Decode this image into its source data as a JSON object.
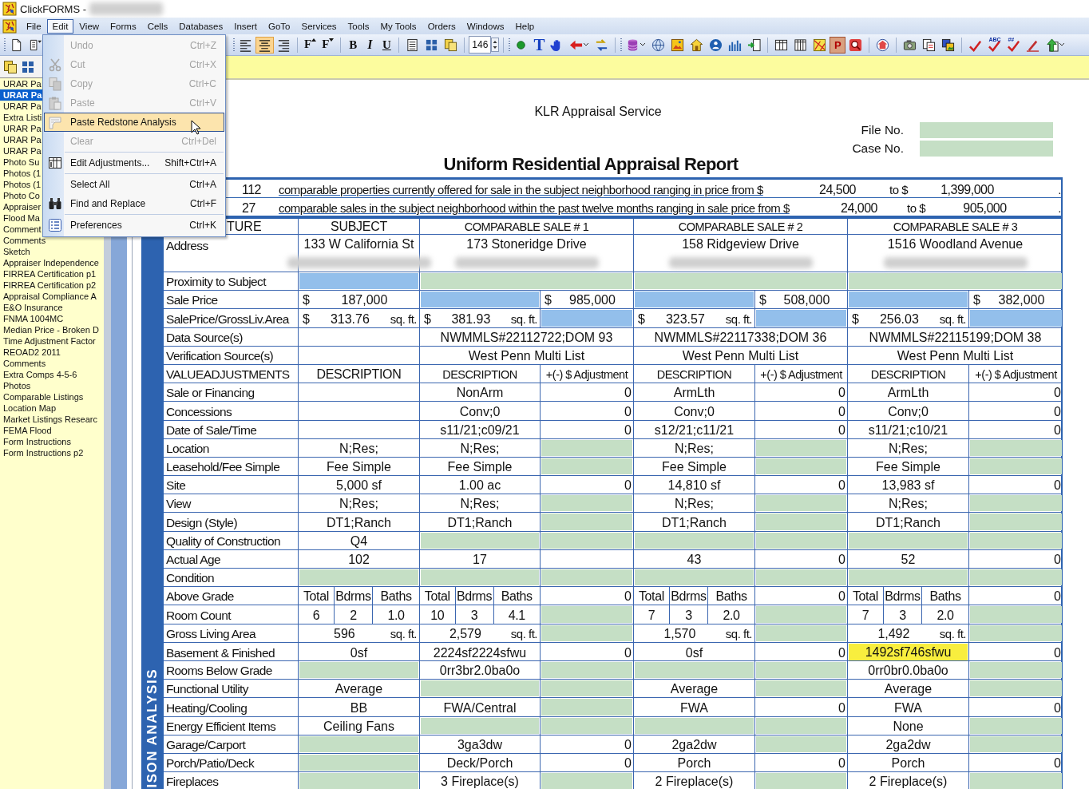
{
  "window": {
    "title": "ClickFORMS -"
  },
  "menubar": [
    {
      "label": "File",
      "selected": false
    },
    {
      "label": "Edit",
      "selected": true
    },
    {
      "label": "View",
      "selected": false
    },
    {
      "label": "Forms",
      "selected": false
    },
    {
      "label": "Cells",
      "selected": false
    },
    {
      "label": "Databases",
      "selected": false
    },
    {
      "label": "Insert",
      "selected": false
    },
    {
      "label": "GoTo",
      "selected": false
    },
    {
      "label": "Services",
      "selected": false
    },
    {
      "label": "Tools",
      "selected": false
    },
    {
      "label": "My Tools",
      "selected": false
    },
    {
      "label": "Orders",
      "selected": false
    },
    {
      "label": "Windows",
      "selected": false
    },
    {
      "label": "Help",
      "selected": false
    }
  ],
  "toolbar": {
    "left": [
      {
        "kind": "grip"
      },
      {
        "kind": "new",
        "pressed": false
      },
      {
        "kind": "docmenu",
        "pressed": false
      }
    ],
    "right": [
      {
        "kind": "grip"
      },
      {
        "kind": "alignleft",
        "pressed": false
      },
      {
        "kind": "aligncenter",
        "pressed": true
      },
      {
        "kind": "alignright",
        "pressed": false
      },
      {
        "kind": "sep"
      },
      {
        "kind": "fontup",
        "text": "F",
        "pressed": false
      },
      {
        "kind": "fontdown",
        "text": "F",
        "pressed": false
      },
      {
        "kind": "sep"
      },
      {
        "kind": "bold",
        "text": "B",
        "pressed": false
      },
      {
        "kind": "italic",
        "text": "I",
        "pressed": false
      },
      {
        "kind": "underline",
        "text": "U",
        "pressed": false
      },
      {
        "kind": "sep"
      },
      {
        "kind": "list",
        "pressed": false
      },
      {
        "kind": "grid",
        "pressed": false
      },
      {
        "kind": "pages",
        "pressed": false
      },
      {
        "kind": "sep"
      },
      {
        "kind": "spin",
        "value": "146"
      },
      {
        "kind": "sep"
      },
      {
        "kind": "grip"
      },
      {
        "kind": "dot",
        "pressed": false
      },
      {
        "kind": "texttool",
        "text": "T",
        "pressed": false
      },
      {
        "kind": "hand",
        "pressed": false
      },
      {
        "kind": "arrow",
        "dropdown": true,
        "pressed": false
      },
      {
        "kind": "swap",
        "pressed": false
      },
      {
        "kind": "sep"
      },
      {
        "kind": "grip"
      },
      {
        "kind": "database",
        "dropdown": true,
        "pressed": false
      },
      {
        "kind": "globe",
        "pressed": false
      },
      {
        "kind": "picture",
        "pressed": false
      },
      {
        "kind": "house",
        "pressed": false
      },
      {
        "kind": "user",
        "pressed": false
      },
      {
        "kind": "chart",
        "pressed": false
      },
      {
        "kind": "import",
        "pressed": false
      },
      {
        "kind": "sep"
      },
      {
        "kind": "table",
        "pressed": false
      },
      {
        "kind": "columns",
        "pressed": false
      },
      {
        "kind": "map",
        "pressed": false
      },
      {
        "kind": "letter",
        "text": "P",
        "pressed": false
      },
      {
        "kind": "search",
        "pressed": false
      },
      {
        "kind": "sep"
      },
      {
        "kind": "housecircle",
        "pressed": false
      },
      {
        "kind": "sep"
      },
      {
        "kind": "camera",
        "pressed": false
      },
      {
        "kind": "docs",
        "pressed": false
      },
      {
        "kind": "photos",
        "pressed": false
      },
      {
        "kind": "sep"
      },
      {
        "kind": "check",
        "pressed": false
      },
      {
        "kind": "check",
        "text": "ABC",
        "pressed": false
      },
      {
        "kind": "check",
        "text": "##",
        "pressed": false
      },
      {
        "kind": "pen",
        "pressed": false
      },
      {
        "kind": "upload",
        "dropdown": true,
        "pressed": false
      }
    ]
  },
  "edit_menu": [
    {
      "kind": "plain",
      "label": "Undo",
      "shortcut": "Ctrl+Z",
      "disabled": true,
      "selected": false
    },
    {
      "kind": "cut",
      "label": "Cut",
      "shortcut": "Ctrl+X",
      "disabled": true,
      "selected": false
    },
    {
      "kind": "copy",
      "label": "Copy",
      "shortcut": "Ctrl+C",
      "disabled": true,
      "selected": false
    },
    {
      "kind": "paste",
      "label": "Paste",
      "shortcut": "Ctrl+V",
      "disabled": true,
      "selected": false
    },
    {
      "kind": "pastespecial",
      "label": "Paste Redstone Analysis",
      "disabled": false,
      "selected": true
    },
    {
      "kind": "plain",
      "label": "Clear",
      "shortcut": "Ctrl+Del",
      "disabled": true,
      "selected": false
    },
    {
      "kind": "separator"
    },
    {
      "kind": "adjust",
      "label": "Edit Adjustments...",
      "shortcut": "Shift+Ctrl+A",
      "disabled": false,
      "selected": false
    },
    {
      "kind": "separator"
    },
    {
      "kind": "plain",
      "label": "Select All",
      "shortcut": "Ctrl+A",
      "disabled": false,
      "selected": false
    },
    {
      "kind": "find",
      "label": "Find and Replace",
      "shortcut": "Ctrl+F",
      "disabled": false,
      "selected": false
    },
    {
      "kind": "separator"
    },
    {
      "kind": "prefs",
      "label": "Preferences",
      "shortcut": "Ctrl+K",
      "disabled": false,
      "selected": false
    }
  ],
  "sidebar": {
    "tools": [
      {
        "kind": "pages"
      },
      {
        "kind": "grid"
      }
    ],
    "items": [
      {
        "label": "URAR Pa",
        "selected": false
      },
      {
        "label": "URAR Pa",
        "selected": true
      },
      {
        "label": "URAR Pa",
        "selected": false
      },
      {
        "label": "Extra Listi",
        "selected": false
      },
      {
        "label": "URAR Pa",
        "selected": false
      },
      {
        "label": "URAR Pa",
        "selected": false
      },
      {
        "label": "URAR Pa",
        "selected": false
      },
      {
        "label": "Photo Su",
        "selected": false
      },
      {
        "label": "Photos (1",
        "selected": false
      },
      {
        "label": "Photos (1",
        "selected": false
      },
      {
        "label": "Photo Co",
        "selected": false
      },
      {
        "label": "Appraiser",
        "selected": false
      },
      {
        "label": "Flood Ma",
        "selected": false
      },
      {
        "label": "Comment",
        "selected": false
      },
      {
        "label": "Comments",
        "selected": false
      },
      {
        "label": "Sketch",
        "selected": false
      },
      {
        "label": "Appraiser Independence",
        "selected": false
      },
      {
        "label": "FIRREA Certification p1",
        "selected": false
      },
      {
        "label": "FIRREA Certification p2",
        "selected": false
      },
      {
        "label": "Appraisal Compliance A",
        "selected": false
      },
      {
        "label": "E&O Insurance",
        "selected": false
      },
      {
        "label": "FNMA 1004MC",
        "selected": false
      },
      {
        "label": "Median Price - Broken D",
        "selected": false
      },
      {
        "label": "Time Adjustment Factor",
        "selected": false
      },
      {
        "label": "REOAD2 2011",
        "selected": false
      },
      {
        "label": "Comments",
        "selected": false
      },
      {
        "label": "Extra Comps 4-5-6",
        "selected": false
      },
      {
        "label": "Photos",
        "selected": false
      },
      {
        "label": "Comparable Listings",
        "selected": false
      },
      {
        "label": "Location Map",
        "selected": false
      },
      {
        "label": "Market Listings Researc",
        "selected": false
      },
      {
        "label": "FEMA Flood",
        "selected": false
      },
      {
        "label": "Form Instructions",
        "selected": false
      },
      {
        "label": "Form Instructions p2",
        "selected": false
      }
    ]
  },
  "report": {
    "company": "KLR Appraisal Service",
    "ids": [
      {
        "label": "File No."
      },
      {
        "label": "Case No."
      }
    ],
    "title": "Uniform Residential Appraisal Report",
    "band": "ISON ANALYSIS",
    "summary": [
      {
        "count": "112",
        "text": "comparable properties currently offered for sale in the subject neighborhood ranging in price from $",
        "low": "24,500",
        "to": "to $",
        "high": "1,399,000",
        "end": "."
      },
      {
        "count": "27",
        "text": "comparable sales in the subject neighborhood within the past twelve months ranging in sale price from $",
        "low": "24,000",
        "to": "to $",
        "high": "905,000",
        "end": "."
      }
    ],
    "rows": [
      {
        "kind": "header",
        "label": "TURE",
        "cells": [
          {
            "kind": "head",
            "text": "SUBJECT"
          },
          {
            "kind": "head",
            "text": "COMPARABLE SALE # 1"
          },
          {
            "kind": "head",
            "text": "COMPARABLE SALE # 2"
          },
          {
            "kind": "head",
            "text": "COMPARABLE SALE # 3"
          }
        ]
      },
      {
        "kind": "address",
        "label": "Address",
        "cells": [
          {
            "kind": "address",
            "text": "133 W California St"
          },
          {
            "kind": "address",
            "text": "173 Stoneridge Drive"
          },
          {
            "kind": "address",
            "text": "158 Ridgeview Drive"
          },
          {
            "kind": "address",
            "text": "1516 Woodland Avenue"
          }
        ]
      },
      {
        "kind": "normal",
        "label": "Proximity to Subject",
        "cells": [
          {
            "kind": "calc"
          },
          {
            "kind": "empty"
          },
          {
            "kind": "empty"
          },
          {
            "kind": "empty"
          }
        ]
      },
      {
        "kind": "normal",
        "label": "Sale Price",
        "cells": [
          {
            "kind": "money",
            "currency": "$",
            "text": "187,000"
          },
          {
            "kind": "calc"
          },
          {
            "kind": "money",
            "currency": "$",
            "text": "985,000"
          },
          {
            "kind": "calc"
          },
          {
            "kind": "money",
            "currency": "$",
            "text": "508,000"
          },
          {
            "kind": "calc"
          },
          {
            "kind": "money",
            "currency": "$",
            "text": "382,000"
          }
        ]
      },
      {
        "kind": "normal",
        "label": "SalePrice/GrossLiv.Area",
        "cells": [
          {
            "kind": "ppsf",
            "currency": "$",
            "text": "313.76",
            "unit": "sq. ft."
          },
          {
            "kind": "ppsf",
            "currency": "$",
            "text": "381.93",
            "unit": "sq. ft."
          },
          {
            "kind": "calc"
          },
          {
            "kind": "ppsf",
            "currency": "$",
            "text": "323.57",
            "unit": "sq. ft."
          },
          {
            "kind": "calc"
          },
          {
            "kind": "ppsf",
            "currency": "$",
            "text": "256.03",
            "unit": "sq. ft."
          },
          {
            "kind": "calc"
          }
        ]
      },
      {
        "kind": "normal",
        "label": "Data Source(s)",
        "cells": [
          {
            "kind": "blank"
          },
          {
            "kind": "text",
            "text": "NWMMLS#22112722;DOM 93"
          },
          {
            "kind": "text",
            "text": "NWMMLS#22117338;DOM 36"
          },
          {
            "kind": "text",
            "text": "NWMMLS#22115199;DOM 38"
          }
        ]
      },
      {
        "kind": "normal",
        "label": "Verification Source(s)",
        "cells": [
          {
            "kind": "blank"
          },
          {
            "kind": "text",
            "text": "West Penn Multi List"
          },
          {
            "kind": "text",
            "text": "West Penn Multi List"
          },
          {
            "kind": "text",
            "text": "West Penn Multi List"
          }
        ]
      },
      {
        "kind": "normal",
        "label": "VALUEADJUSTMENTS",
        "cells": [
          {
            "kind": "head",
            "text": "DESCRIPTION"
          },
          {
            "kind": "head",
            "text": "DESCRIPTION"
          },
          {
            "kind": "head",
            "text": "+(-) $ Adjustment"
          },
          {
            "kind": "head",
            "text": "DESCRIPTION"
          },
          {
            "kind": "head",
            "text": "+(-) $ Adjustment"
          },
          {
            "kind": "head",
            "text": "DESCRIPTION"
          },
          {
            "kind": "head",
            "text": "+(-) $ Adjustment"
          }
        ]
      },
      {
        "kind": "normal",
        "label": "Sale or Financing",
        "cells": [
          {
            "kind": "blank"
          },
          {
            "kind": "text",
            "text": "NonArm"
          },
          {
            "kind": "adj",
            "text": "0"
          },
          {
            "kind": "text",
            "text": "ArmLth"
          },
          {
            "kind": "adj",
            "text": "0"
          },
          {
            "kind": "text",
            "text": "ArmLth"
          },
          {
            "kind": "adj",
            "text": "0"
          }
        ]
      },
      {
        "kind": "normal",
        "label": "Concessions",
        "cells": [
          {
            "kind": "blank"
          },
          {
            "kind": "text",
            "text": "Conv;0"
          },
          {
            "kind": "adj",
            "text": "0"
          },
          {
            "kind": "text",
            "text": "Conv;0"
          },
          {
            "kind": "adj",
            "text": "0"
          },
          {
            "kind": "text",
            "text": "Conv;0"
          },
          {
            "kind": "adj",
            "text": "0"
          }
        ]
      },
      {
        "kind": "normal",
        "label": "Date of Sale/Time",
        "cells": [
          {
            "kind": "blank"
          },
          {
            "kind": "text",
            "text": "s11/21;c09/21"
          },
          {
            "kind": "adj",
            "text": "0"
          },
          {
            "kind": "text",
            "text": "s12/21;c11/21"
          },
          {
            "kind": "adj",
            "text": "0"
          },
          {
            "kind": "text",
            "text": "s11/21;c10/21"
          },
          {
            "kind": "adj",
            "text": "0"
          }
        ]
      },
      {
        "kind": "normal",
        "label": "Location",
        "cells": [
          {
            "kind": "text",
            "text": "N;Res;"
          },
          {
            "kind": "text",
            "text": "N;Res;"
          },
          {
            "kind": "empty"
          },
          {
            "kind": "text",
            "text": "N;Res;"
          },
          {
            "kind": "empty"
          },
          {
            "kind": "text",
            "text": "N;Res;"
          },
          {
            "kind": "empty"
          }
        ]
      },
      {
        "kind": "normal",
        "label": "Leasehold/Fee Simple",
        "cells": [
          {
            "kind": "text",
            "text": "Fee Simple"
          },
          {
            "kind": "text",
            "text": "Fee Simple"
          },
          {
            "kind": "empty"
          },
          {
            "kind": "text",
            "text": "Fee Simple"
          },
          {
            "kind": "empty"
          },
          {
            "kind": "text",
            "text": "Fee Simple"
          },
          {
            "kind": "empty"
          }
        ]
      },
      {
        "kind": "normal",
        "label": "Site",
        "cells": [
          {
            "kind": "text",
            "text": "5,000 sf"
          },
          {
            "kind": "text",
            "text": "1.00 ac"
          },
          {
            "kind": "adj",
            "text": "0"
          },
          {
            "kind": "text",
            "text": "14,810 sf"
          },
          {
            "kind": "adj",
            "text": "0"
          },
          {
            "kind": "text",
            "text": "13,983 sf"
          },
          {
            "kind": "adj",
            "text": "0"
          }
        ]
      },
      {
        "kind": "normal",
        "label": "View",
        "cells": [
          {
            "kind": "text",
            "text": "N;Res;"
          },
          {
            "kind": "text",
            "text": "N;Res;"
          },
          {
            "kind": "empty"
          },
          {
            "kind": "text",
            "text": "N;Res;"
          },
          {
            "kind": "empty"
          },
          {
            "kind": "text",
            "text": "N;Res;"
          },
          {
            "kind": "empty"
          }
        ]
      },
      {
        "kind": "normal",
        "label": "Design (Style)",
        "cells": [
          {
            "kind": "text",
            "text": "DT1;Ranch"
          },
          {
            "kind": "text",
            "text": "DT1;Ranch"
          },
          {
            "kind": "empty"
          },
          {
            "kind": "text",
            "text": "DT1;Ranch"
          },
          {
            "kind": "empty"
          },
          {
            "kind": "text",
            "text": "DT1;Ranch"
          },
          {
            "kind": "empty"
          }
        ]
      },
      {
        "kind": "normal",
        "label": "Quality of Construction",
        "cells": [
          {
            "kind": "text",
            "text": "Q4"
          },
          {
            "kind": "empty"
          },
          {
            "kind": "empty"
          },
          {
            "kind": "empty"
          },
          {
            "kind": "empty"
          },
          {
            "kind": "empty"
          },
          {
            "kind": "empty"
          }
        ]
      },
      {
        "kind": "normal",
        "label": "Actual Age",
        "cells": [
          {
            "kind": "text",
            "text": "102"
          },
          {
            "kind": "text",
            "text": "17"
          },
          {
            "kind": "blank"
          },
          {
            "kind": "text",
            "text": "43"
          },
          {
            "kind": "adj",
            "text": "0"
          },
          {
            "kind": "text",
            "text": "52"
          },
          {
            "kind": "adj",
            "text": "0"
          }
        ]
      },
      {
        "kind": "normal",
        "label": "Condition",
        "cells": [
          {
            "kind": "empty"
          },
          {
            "kind": "empty"
          },
          {
            "kind": "empty"
          },
          {
            "kind": "empty"
          },
          {
            "kind": "empty"
          },
          {
            "kind": "empty"
          },
          {
            "kind": "empty"
          }
        ]
      },
      {
        "kind": "normal",
        "label": "Above Grade",
        "cells": [
          {
            "kind": "split",
            "parts": [
              "Total",
              "Bdrms",
              "Baths"
            ]
          },
          {
            "kind": "split",
            "parts": [
              "Total",
              "Bdrms",
              "Baths"
            ]
          },
          {
            "kind": "adj",
            "text": "0"
          },
          {
            "kind": "split",
            "parts": [
              "Total",
              "Bdrms",
              "Baths"
            ]
          },
          {
            "kind": "adj",
            "text": "0"
          },
          {
            "kind": "split",
            "parts": [
              "Total",
              "Bdrms",
              "Baths"
            ]
          },
          {
            "kind": "adj",
            "text": "0"
          }
        ]
      },
      {
        "kind": "normal",
        "label": "Room Count",
        "cells": [
          {
            "kind": "split",
            "parts": [
              "6",
              "2",
              "1.0"
            ]
          },
          {
            "kind": "split",
            "parts": [
              "10",
              "3",
              "4.1"
            ]
          },
          {
            "kind": "empty"
          },
          {
            "kind": "split",
            "parts": [
              "7",
              "3",
              "2.0"
            ]
          },
          {
            "kind": "empty"
          },
          {
            "kind": "split",
            "parts": [
              "7",
              "3",
              "2.0"
            ]
          },
          {
            "kind": "empty"
          }
        ]
      },
      {
        "kind": "normal",
        "label": "Gross Living Area",
        "cells": [
          {
            "kind": "area",
            "text": "596",
            "unit": "sq. ft."
          },
          {
            "kind": "area",
            "text": "2,579",
            "unit": "sq. ft."
          },
          {
            "kind": "empty"
          },
          {
            "kind": "area",
            "text": "1,570",
            "unit": "sq. ft."
          },
          {
            "kind": "empty"
          },
          {
            "kind": "area",
            "text": "1,492",
            "unit": "sq. ft."
          },
          {
            "kind": "empty"
          }
        ]
      },
      {
        "kind": "normal",
        "label": "Basement & Finished",
        "cells": [
          {
            "kind": "text",
            "text": "0sf"
          },
          {
            "kind": "text",
            "text": "2224sf2224sfwu"
          },
          {
            "kind": "adj",
            "text": "0"
          },
          {
            "kind": "text",
            "text": "0sf"
          },
          {
            "kind": "adj",
            "text": "0"
          },
          {
            "kind": "text",
            "text": "1492sf746sfwu",
            "highlighted": true
          },
          {
            "kind": "adj",
            "text": "0"
          }
        ]
      },
      {
        "kind": "normal",
        "label": "Rooms Below Grade",
        "cells": [
          {
            "kind": "empty"
          },
          {
            "kind": "text",
            "text": "0rr3br2.0ba0o"
          },
          {
            "kind": "empty"
          },
          {
            "kind": "empty"
          },
          {
            "kind": "empty"
          },
          {
            "kind": "text",
            "text": "0rr0br0.0ba0o"
          },
          {
            "kind": "empty"
          }
        ]
      },
      {
        "kind": "normal",
        "label": "Functional Utility",
        "cells": [
          {
            "kind": "text",
            "text": "Average"
          },
          {
            "kind": "empty"
          },
          {
            "kind": "empty"
          },
          {
            "kind": "text",
            "text": "Average"
          },
          {
            "kind": "empty"
          },
          {
            "kind": "text",
            "text": "Average"
          },
          {
            "kind": "empty"
          }
        ]
      },
      {
        "kind": "normal",
        "label": "Heating/Cooling",
        "cells": [
          {
            "kind": "text",
            "text": "BB"
          },
          {
            "kind": "text",
            "text": "FWA/Central"
          },
          {
            "kind": "empty"
          },
          {
            "kind": "text",
            "text": "FWA"
          },
          {
            "kind": "adj",
            "text": "0"
          },
          {
            "kind": "text",
            "text": "FWA"
          },
          {
            "kind": "adj",
            "text": "0"
          }
        ]
      },
      {
        "kind": "normal",
        "label": "Energy Efficient Items",
        "cells": [
          {
            "kind": "text",
            "text": "Ceiling Fans"
          },
          {
            "kind": "empty"
          },
          {
            "kind": "empty"
          },
          {
            "kind": "empty"
          },
          {
            "kind": "empty"
          },
          {
            "kind": "text",
            "text": "None"
          },
          {
            "kind": "empty"
          }
        ]
      },
      {
        "kind": "normal",
        "label": "Garage/Carport",
        "cells": [
          {
            "kind": "empty"
          },
          {
            "kind": "text",
            "text": "3ga3dw"
          },
          {
            "kind": "adj",
            "text": "0"
          },
          {
            "kind": "text",
            "text": "2ga2dw"
          },
          {
            "kind": "empty"
          },
          {
            "kind": "text",
            "text": "2ga2dw"
          },
          {
            "kind": "empty"
          }
        ]
      },
      {
        "kind": "normal",
        "label": "Porch/Patio/Deck",
        "cells": [
          {
            "kind": "empty"
          },
          {
            "kind": "text",
            "text": "Deck/Porch"
          },
          {
            "kind": "adj",
            "text": "0"
          },
          {
            "kind": "text",
            "text": "Porch"
          },
          {
            "kind": "adj",
            "text": "0"
          },
          {
            "kind": "text",
            "text": "Porch"
          },
          {
            "kind": "adj",
            "text": "0"
          }
        ]
      },
      {
        "kind": "normal",
        "label": "Fireplaces",
        "cells": [
          {
            "kind": "empty"
          },
          {
            "kind": "text",
            "text": "3 Fireplace(s)"
          },
          {
            "kind": "empty"
          },
          {
            "kind": "text",
            "text": "2 Fireplace(s)"
          },
          {
            "kind": "empty"
          },
          {
            "kind": "text",
            "text": "2 Fireplace(s)"
          },
          {
            "kind": "empty"
          }
        ]
      }
    ]
  }
}
